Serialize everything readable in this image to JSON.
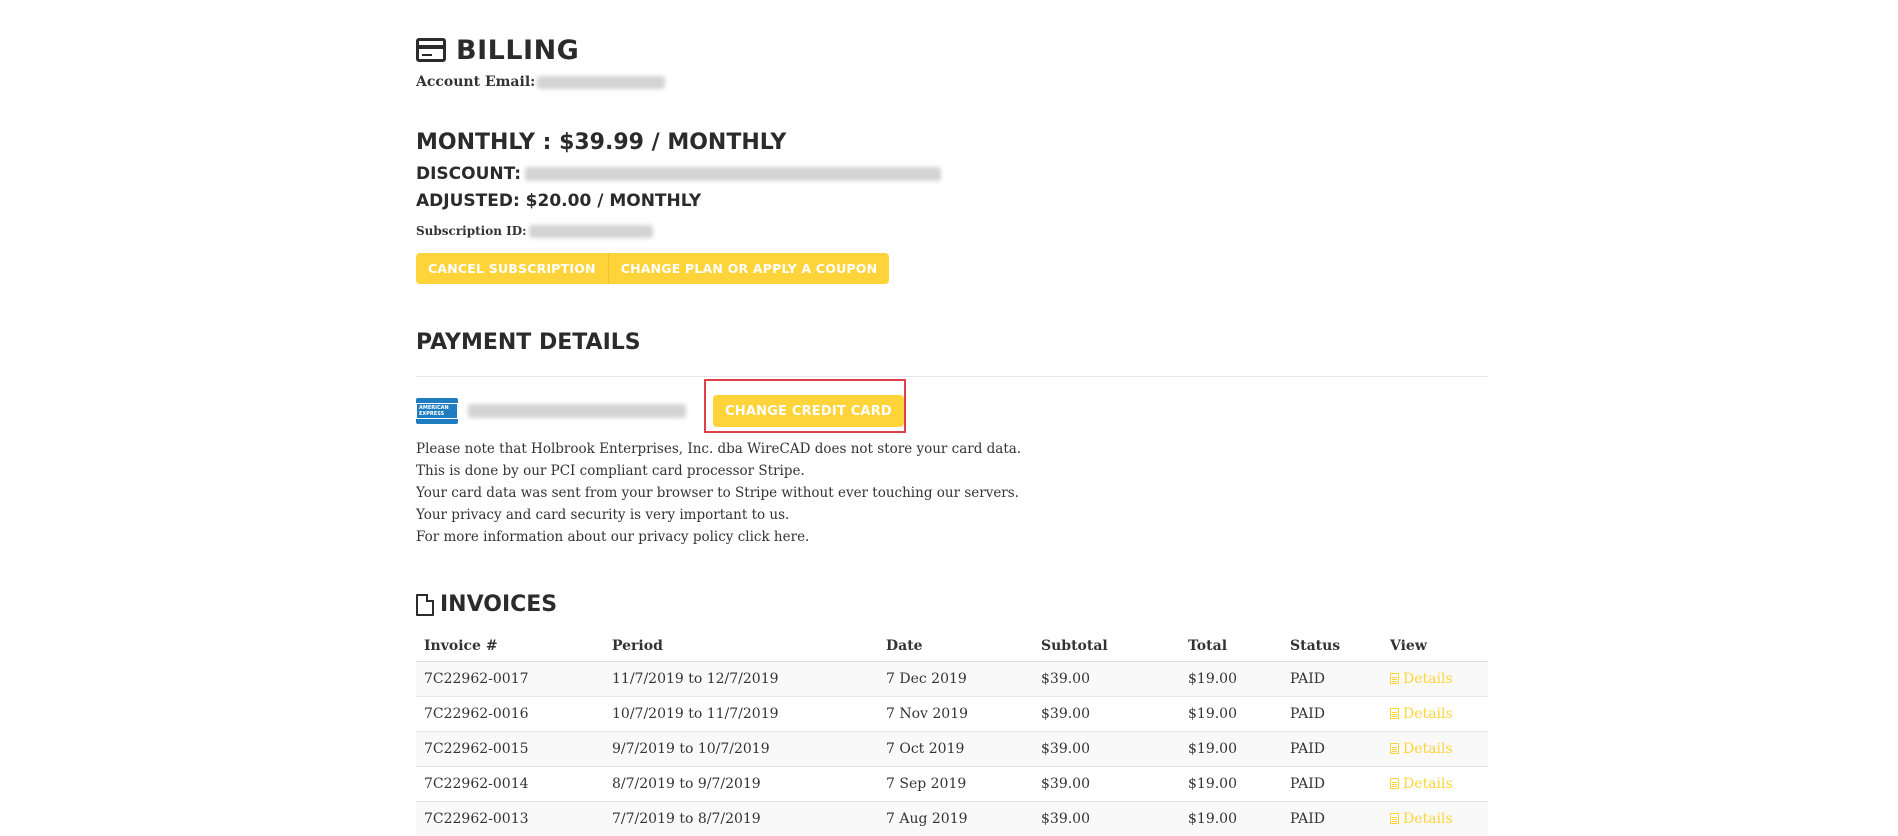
{
  "billing": {
    "title": "BILLING",
    "icon": "credit-card-icon",
    "account_email_label": "Account Email:"
  },
  "subscription": {
    "plan_line": "MONTHLY : $39.99 / MONTHLY",
    "discount_label": "DISCOUNT:",
    "adjusted_line": "ADJUSTED: $20.00 / MONTHLY",
    "subscription_id_label": "Subscription ID:",
    "cancel_button": "CANCEL SUBSCRIPTION",
    "change_plan_button": "CHANGE PLAN OR APPLY A COUPON"
  },
  "payment": {
    "title": "PAYMENT DETAILS",
    "card_brand_label": "AMERICAN EXPRESS",
    "change_card_button": "CHANGE CREDIT CARD",
    "notes": [
      "Please note that Holbrook Enterprises, Inc. dba WireCAD does not store your card data.",
      "This is done by our PCI compliant card processor Stripe.",
      "Your card data was sent from your browser to Stripe without ever touching our servers.",
      "Your privacy and card security is very important to us.",
      "For more information about our privacy policy click here."
    ]
  },
  "invoices": {
    "title": "INVOICES",
    "icon": "file-icon",
    "columns": [
      "Invoice #",
      "Period",
      "Date",
      "Subtotal",
      "Total",
      "Status",
      "View"
    ],
    "rows": [
      {
        "invoice": "7C22962-0017",
        "period": "11/7/2019 to 12/7/2019",
        "date": "7 Dec 2019",
        "subtotal": "$39.00",
        "total": "$19.00",
        "status": "PAID",
        "view": "Details"
      },
      {
        "invoice": "7C22962-0016",
        "period": "10/7/2019 to 11/7/2019",
        "date": "7 Nov 2019",
        "subtotal": "$39.00",
        "total": "$19.00",
        "status": "PAID",
        "view": "Details"
      },
      {
        "invoice": "7C22962-0015",
        "period": "9/7/2019 to 10/7/2019",
        "date": "7 Oct 2019",
        "subtotal": "$39.00",
        "total": "$19.00",
        "status": "PAID",
        "view": "Details"
      },
      {
        "invoice": "7C22962-0014",
        "period": "8/7/2019 to 9/7/2019",
        "date": "7 Sep 2019",
        "subtotal": "$39.00",
        "total": "$19.00",
        "status": "PAID",
        "view": "Details"
      },
      {
        "invoice": "7C22962-0013",
        "period": "7/7/2019 to 8/7/2019",
        "date": "7 Aug 2019",
        "subtotal": "$39.00",
        "total": "$19.00",
        "status": "PAID",
        "view": "Details"
      }
    ]
  },
  "colors": {
    "accent": "#ffd43b",
    "highlight_border": "#e0404a",
    "amex_blue": "#1f7dbf"
  }
}
